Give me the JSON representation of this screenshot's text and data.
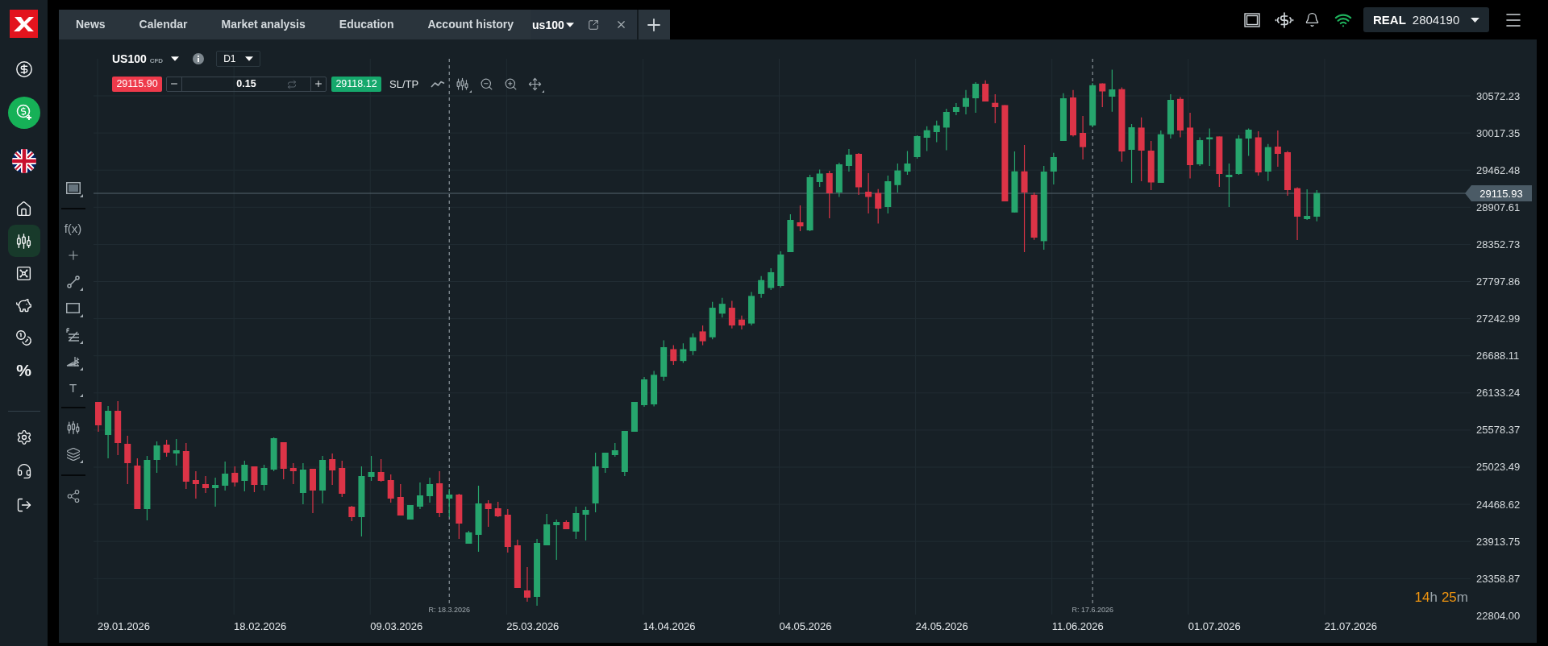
{
  "sidebar": {
    "nav_items": [
      {
        "selected": false
      },
      {
        "selected": true
      },
      {
        "selected": false
      },
      {
        "selected": false
      },
      {
        "selected": false
      },
      {
        "label": "%",
        "selected": false
      }
    ]
  },
  "tabs": [
    {
      "kind": "page",
      "label": "News",
      "selected": false
    },
    {
      "kind": "page",
      "label": "Calendar",
      "selected": false
    },
    {
      "kind": "page",
      "label": "Market analysis",
      "selected": false
    },
    {
      "kind": "page",
      "label": "Education",
      "selected": false
    },
    {
      "kind": "page",
      "label": "Account history",
      "selected": false
    },
    {
      "kind": "instrument",
      "label": "us100",
      "selected": true
    }
  ],
  "account": {
    "mode": "REAL",
    "number": "2804190"
  },
  "instrument": {
    "symbol": "US100",
    "type": "CFD",
    "timeframe": "D1"
  },
  "order": {
    "sell_price": "29115.90",
    "volume": "0.15",
    "buy_price": "29118.12",
    "sltp_label": "SL/TP"
  },
  "chart_tools": {
    "indicators_label": "f(x)",
    "text_tool_label": "T"
  },
  "price_axis": {
    "labels": [
      "30572.23",
      "30017.35",
      "29462.48",
      "28907.61",
      "28352.73",
      "27797.86",
      "27242.99",
      "26688.11",
      "26133.24",
      "25578.37",
      "25023.49",
      "24468.62",
      "23913.75",
      "23358.87",
      "22804.00"
    ],
    "current_price": "29115.93"
  },
  "time_axis": {
    "labels": [
      "29.01.2026",
      "18.02.2026",
      "09.03.2026",
      "25.03.2026",
      "14.04.2026",
      "04.05.2026",
      "24.05.2026",
      "11.06.2026",
      "01.07.2026",
      "21.07.2026"
    ]
  },
  "markers": [
    {
      "label": "R: 18.3.2026"
    },
    {
      "label": "R: 17.6.2026"
    }
  ],
  "countdown": [
    {
      "kind": "number",
      "text": "14"
    },
    {
      "kind": "unit",
      "text": "h"
    },
    {
      "kind": "number",
      "text": "25"
    },
    {
      "kind": "unit",
      "text": "m"
    }
  ]
}
